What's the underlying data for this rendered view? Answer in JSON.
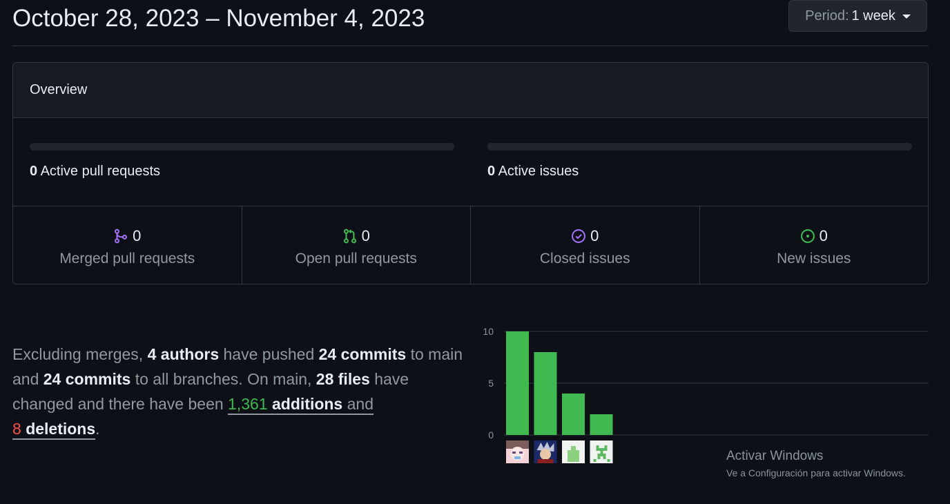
{
  "header": {
    "date_range": "October 28, 2023 – November 4, 2023",
    "period_label": "Period:",
    "period_value": "1 week"
  },
  "overview": {
    "title": "Overview",
    "active_pull_requests": {
      "count": "0",
      "label": "Active pull requests"
    },
    "active_issues": {
      "count": "0",
      "label": "Active issues"
    },
    "stats": [
      {
        "count": "0",
        "label": "Merged pull requests",
        "icon": "git-merge-icon",
        "color": "#a371f7"
      },
      {
        "count": "0",
        "label": "Open pull requests",
        "icon": "git-pull-request-icon",
        "color": "#3fb950"
      },
      {
        "count": "0",
        "label": "Closed issues",
        "icon": "issue-closed-icon",
        "color": "#a371f7"
      },
      {
        "count": "0",
        "label": "New issues",
        "icon": "issue-opened-icon",
        "color": "#3fb950"
      }
    ]
  },
  "summary": {
    "p1": "Excluding merges,",
    "authors": "4 authors",
    "p2": "have pushed",
    "commits_main": "24 commits",
    "p3": "to main and",
    "commits_all": "24 commits",
    "p4": "to all branches. On main,",
    "files": "28 files",
    "p5": "have changed and there have been",
    "additions_num": "1,361",
    "additions_word": "additions",
    "p6": "and",
    "deletions_num": "8",
    "deletions_word": "deletions",
    "end": "."
  },
  "chart_data": {
    "type": "bar",
    "categories": [
      "author-1",
      "author-2",
      "author-3",
      "author-4"
    ],
    "values": [
      10,
      8,
      4,
      2
    ],
    "ylim": [
      0,
      10
    ],
    "yticks": [
      "0",
      "5",
      "10"
    ],
    "grid": true,
    "bar_color": "#3fb950",
    "avatars": [
      "pink-anime-avatar",
      "anime-character-avatar",
      "green-bottle-avatar",
      "green-pixel-creeper-avatar"
    ]
  },
  "watermark": {
    "title": "Activar Windows",
    "subtitle": "Ve a Configuración para activar Windows."
  }
}
